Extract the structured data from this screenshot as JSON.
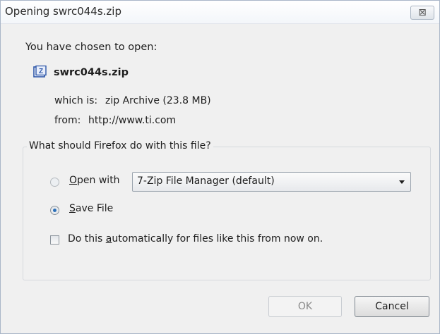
{
  "window": {
    "title": "Opening swrc044s.zip",
    "close_glyph": "⊠"
  },
  "file": {
    "intro": "You have chosen to open:",
    "icon": "zip-file-icon",
    "name": "swrc044s.zip",
    "type_label": "which is:",
    "type_value": "zip Archive (23.8 MB)",
    "from_label": "from:",
    "from_value": "http://www.ti.com"
  },
  "action_group": {
    "title": "What should Firefox do with this file?",
    "open_with": {
      "prefix": "O",
      "rest": "pen with",
      "selected": false
    },
    "app_select": {
      "value": "7-Zip File Manager (default)"
    },
    "save_file": {
      "prefix": "S",
      "rest": "ave File",
      "selected": true
    },
    "auto": {
      "before": "Do this ",
      "accel": "a",
      "after": "utomatically for files like this from now on.",
      "checked": false
    }
  },
  "buttons": {
    "ok": "OK",
    "cancel": "Cancel"
  },
  "colors": {
    "dialog_bg": "#f0f0f0",
    "radio_dot": "#2b6fb8",
    "file_icon": "#2c55a8"
  }
}
